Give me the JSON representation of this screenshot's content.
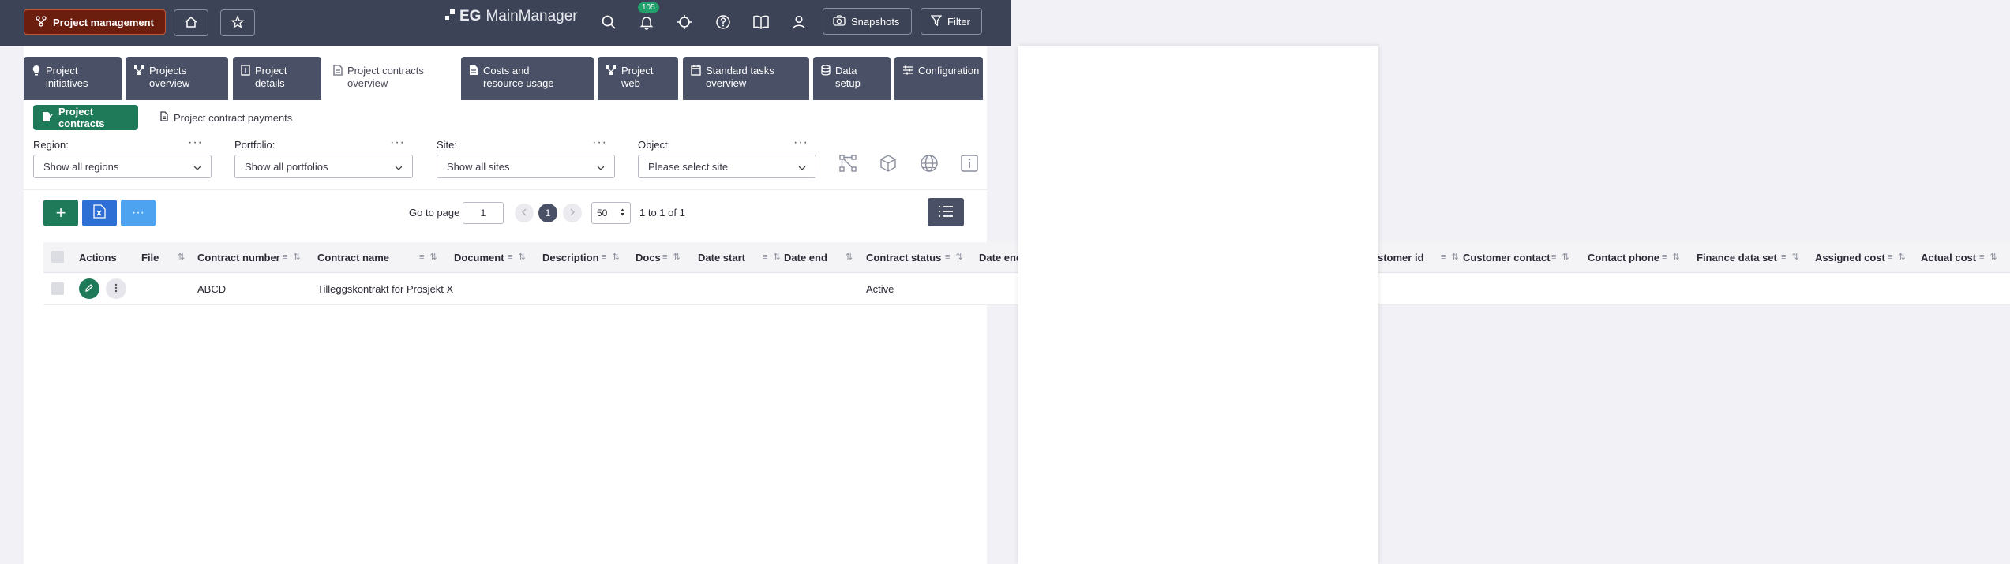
{
  "header": {
    "module_button": "Project management",
    "logo_prefix": "EG",
    "logo_name": "MainManager",
    "notification_count": "105",
    "snapshots_label": "Snapshots",
    "filter_label": "Filter"
  },
  "tabs": [
    {
      "line1": "Project",
      "line2": "initiatives"
    },
    {
      "line1": "Projects",
      "line2": "overview"
    },
    {
      "line1": "Project",
      "line2": "details"
    },
    {
      "line1": "Project contracts",
      "line2": "overview"
    },
    {
      "line1": "Costs and",
      "line2": "resource usage"
    },
    {
      "line1": "Project",
      "line2": "web"
    },
    {
      "line1": "Standard tasks",
      "line2": "overview"
    },
    {
      "line1": "Data",
      "line2": "setup"
    },
    {
      "line1": "Configuration",
      "line2": ""
    }
  ],
  "subtabs": {
    "contracts": "Project contracts",
    "payments": "Project contract payments"
  },
  "filters": {
    "region": {
      "label": "Region:",
      "value": "Show all regions"
    },
    "portfolio": {
      "label": "Portfolio:",
      "value": "Show all portfolios"
    },
    "site": {
      "label": "Site:",
      "value": "Show all sites"
    },
    "object": {
      "label": "Object:",
      "value": "Please select site"
    },
    "more": "···"
  },
  "toolbar": {
    "add": "+",
    "more": "···"
  },
  "pager": {
    "goto_label": "Go to page",
    "page_input": "1",
    "current_page": "1",
    "per_page": "50",
    "range": "1 to 1 of 1"
  },
  "table": {
    "columns": {
      "actions": "Actions",
      "file": "File",
      "contract_number": "Contract number",
      "contract_name": "Contract name",
      "document": "Document",
      "description": "Description",
      "docs": "Docs",
      "date_start": "Date start",
      "date_end": "Date end",
      "contract_status": "Contract status",
      "date_end_2": "Date end",
      "customer_id": "stomer id",
      "customer_contact": "Customer contact",
      "contact_phone": "Contact phone",
      "finance_data_set": "Finance data set",
      "assigned_cost": "Assigned cost",
      "actual_cost": "Actual cost"
    },
    "rows": [
      {
        "contract_number": "ABCD",
        "contract_name": "Tilleggskontrakt for Prosjekt X",
        "contract_status": "Active"
      }
    ]
  },
  "colors": {
    "topbar": "#3d4356",
    "module_button": "#6b1d0e",
    "primary_green": "#1f7a5a",
    "tab_bg": "#4a5065",
    "excel_blue": "#2e6fd6",
    "light_blue": "#4da3f0"
  }
}
